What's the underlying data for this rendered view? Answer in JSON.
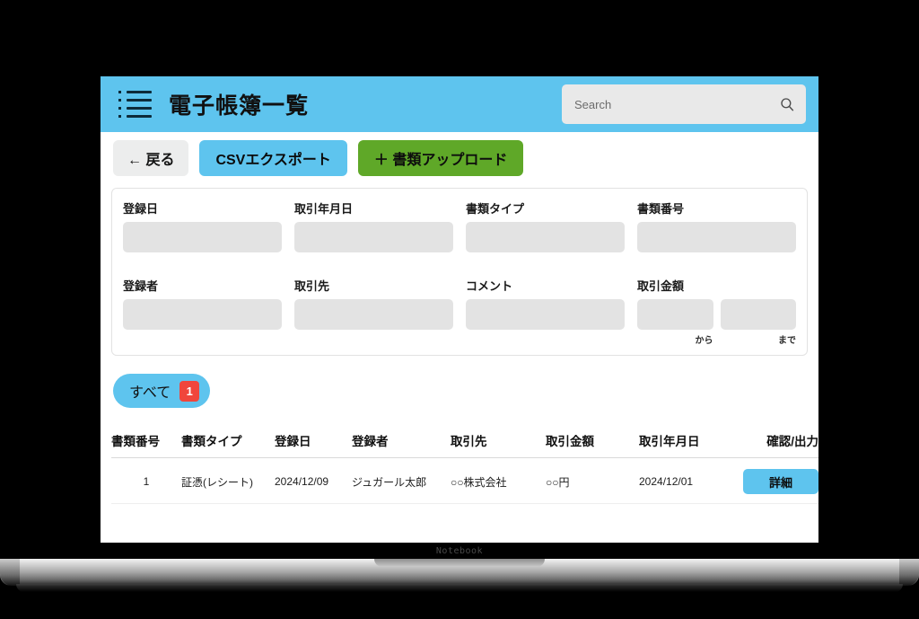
{
  "header": {
    "menu_icon": "list-icon",
    "title": "電子帳簿一覧",
    "search": {
      "placeholder": "Search",
      "value": "",
      "icon": "search-icon"
    },
    "bg_color": "#5ec4ee"
  },
  "toolbar": {
    "back_label": "← 戻る",
    "csv_label": "CSVエクスポート",
    "upload_label": "＋ 書類アップロード",
    "upload_color": "#5fa828",
    "csv_color": "#5ec4ee"
  },
  "filters": {
    "row1": [
      {
        "label": "登録日",
        "value": "",
        "placeholder": ""
      },
      {
        "label": "取引年月日",
        "value": "",
        "placeholder": ""
      },
      {
        "label": "書類タイプ",
        "value": "",
        "placeholder": ""
      },
      {
        "label": "書類番号",
        "value": "",
        "placeholder": ""
      }
    ],
    "row2": [
      {
        "label": "登録者",
        "value": "",
        "placeholder": ""
      },
      {
        "label": "取引先",
        "value": "",
        "placeholder": ""
      },
      {
        "label": "コメント",
        "value": "",
        "placeholder": ""
      }
    ],
    "amount": {
      "label": "取引金額",
      "from_value": "",
      "to_value": "",
      "from_caption": "から",
      "to_caption": "まで"
    }
  },
  "tabs": [
    {
      "label": "すべて",
      "badge": "1",
      "active": true,
      "color": "#5ec4ee",
      "badge_color": "#f0463c"
    }
  ],
  "table": {
    "columns": [
      "書類番号",
      "書類タイプ",
      "登録日",
      "登録者",
      "取引先",
      "取引金額",
      "取引年月日",
      "確認/出力"
    ],
    "rows": [
      {
        "doc_no": "1",
        "doc_type": "証憑(レシート)",
        "reg_date": "2024/12/09",
        "registrant": "ジュガール太郎",
        "partner": "○○株式会社",
        "amount": "○○円",
        "tx_date": "2024/12/01",
        "action_label": "詳細"
      }
    ]
  },
  "device": {
    "label": "Notebook"
  }
}
